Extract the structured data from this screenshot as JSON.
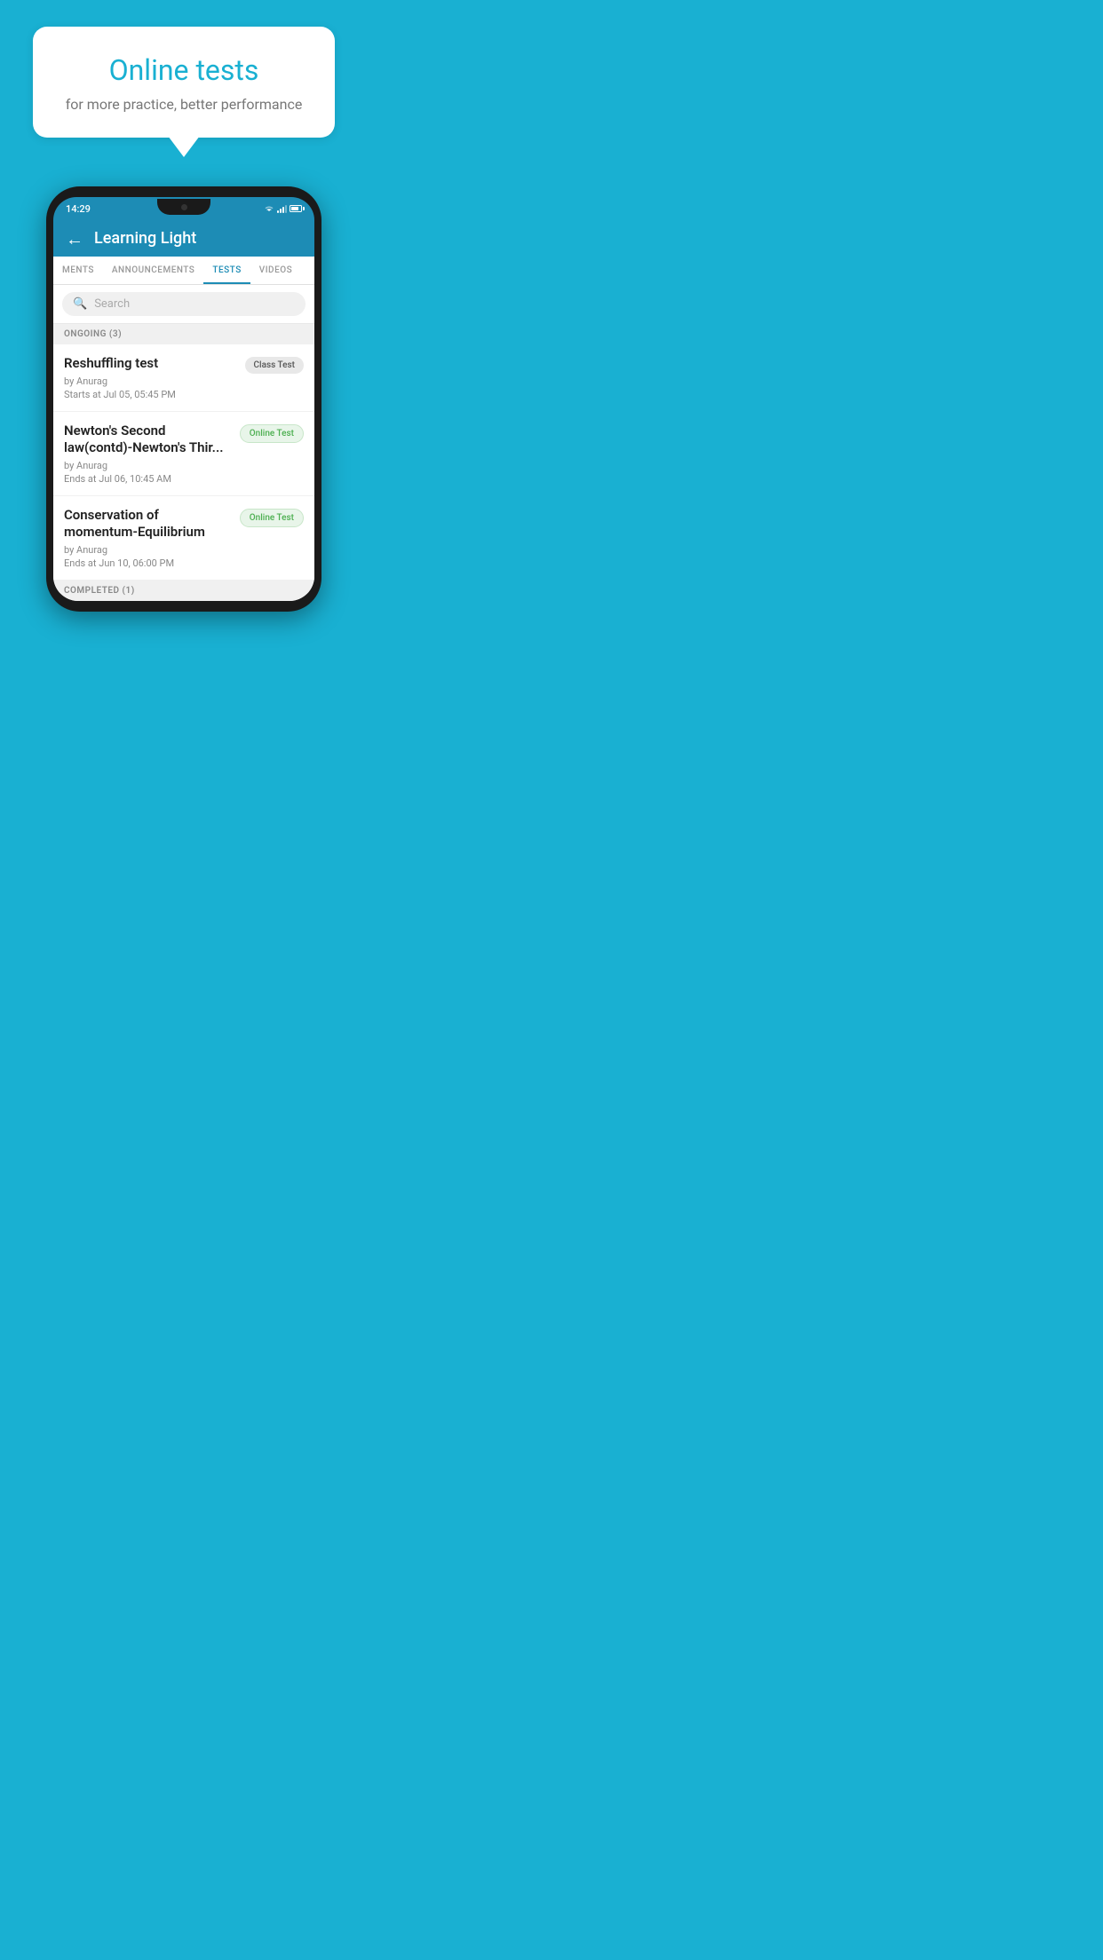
{
  "background_color": "#19b0d2",
  "promo": {
    "title": "Online tests",
    "subtitle": "for more practice, better performance"
  },
  "phone": {
    "status_bar": {
      "time": "14:29"
    },
    "app_header": {
      "title": "Learning Light",
      "back_label": "←"
    },
    "tabs": [
      {
        "label": "MENTS",
        "active": false
      },
      {
        "label": "ANNOUNCEMENTS",
        "active": false
      },
      {
        "label": "TESTS",
        "active": true
      },
      {
        "label": "VIDEOS",
        "active": false
      }
    ],
    "search": {
      "placeholder": "Search"
    },
    "ongoing_section": {
      "label": "ONGOING (3)"
    },
    "tests": [
      {
        "name": "Reshuffling test",
        "by": "by Anurag",
        "time": "Starts at  Jul 05, 05:45 PM",
        "badge": "Class Test",
        "badge_type": "class"
      },
      {
        "name": "Newton's Second law(contd)-Newton's Thir...",
        "by": "by Anurag",
        "time": "Ends at  Jul 06, 10:45 AM",
        "badge": "Online Test",
        "badge_type": "online"
      },
      {
        "name": "Conservation of momentum-Equilibrium",
        "by": "by Anurag",
        "time": "Ends at  Jun 10, 06:00 PM",
        "badge": "Online Test",
        "badge_type": "online"
      }
    ],
    "completed_section": {
      "label": "COMPLETED (1)"
    }
  }
}
